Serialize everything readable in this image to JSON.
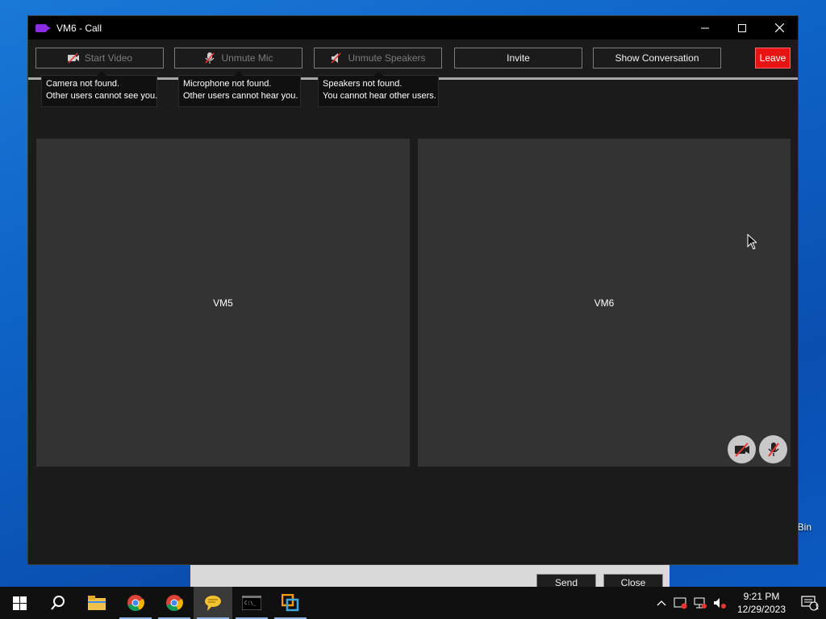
{
  "desktop": {
    "recycle_label": "Bin"
  },
  "background_dialog": {
    "send_label": "Send",
    "close_label": "Close"
  },
  "window": {
    "title": "VM6 - Call",
    "controls": {
      "minimize": "—",
      "maximize": "☐",
      "close": "✕"
    }
  },
  "toolbar": {
    "start_video": "Start Video",
    "unmute_mic": "Unmute Mic",
    "unmute_speakers": "Unmute Speakers",
    "invite": "Invite",
    "show_conversation": "Show Conversation",
    "leave": "Leave"
  },
  "tooltips": {
    "camera": {
      "line1": "Camera not found.",
      "line2": "Other users cannot see you."
    },
    "microphone": {
      "line1": "Microphone not found.",
      "line2": "Other users cannot hear you."
    },
    "speakers": {
      "line1": "Speakers not found.",
      "line2": "You cannot hear other users."
    }
  },
  "participants": [
    {
      "name": "VM5"
    },
    {
      "name": "VM6"
    }
  ],
  "taskbar": {
    "apps": [
      "start-icon",
      "search-icon",
      "file-explorer-icon",
      "chrome-icon",
      "chrome-icon",
      "chat-app-icon",
      "terminal-icon",
      "vmware-icon"
    ],
    "clock_time": "9:21 PM",
    "clock_date": "12/29/2023",
    "notification_count": "1"
  },
  "colors": {
    "leave": "#e81313",
    "tile": "#333333",
    "window_bg": "#1b1b1b",
    "desktop": "#0e63c6"
  }
}
